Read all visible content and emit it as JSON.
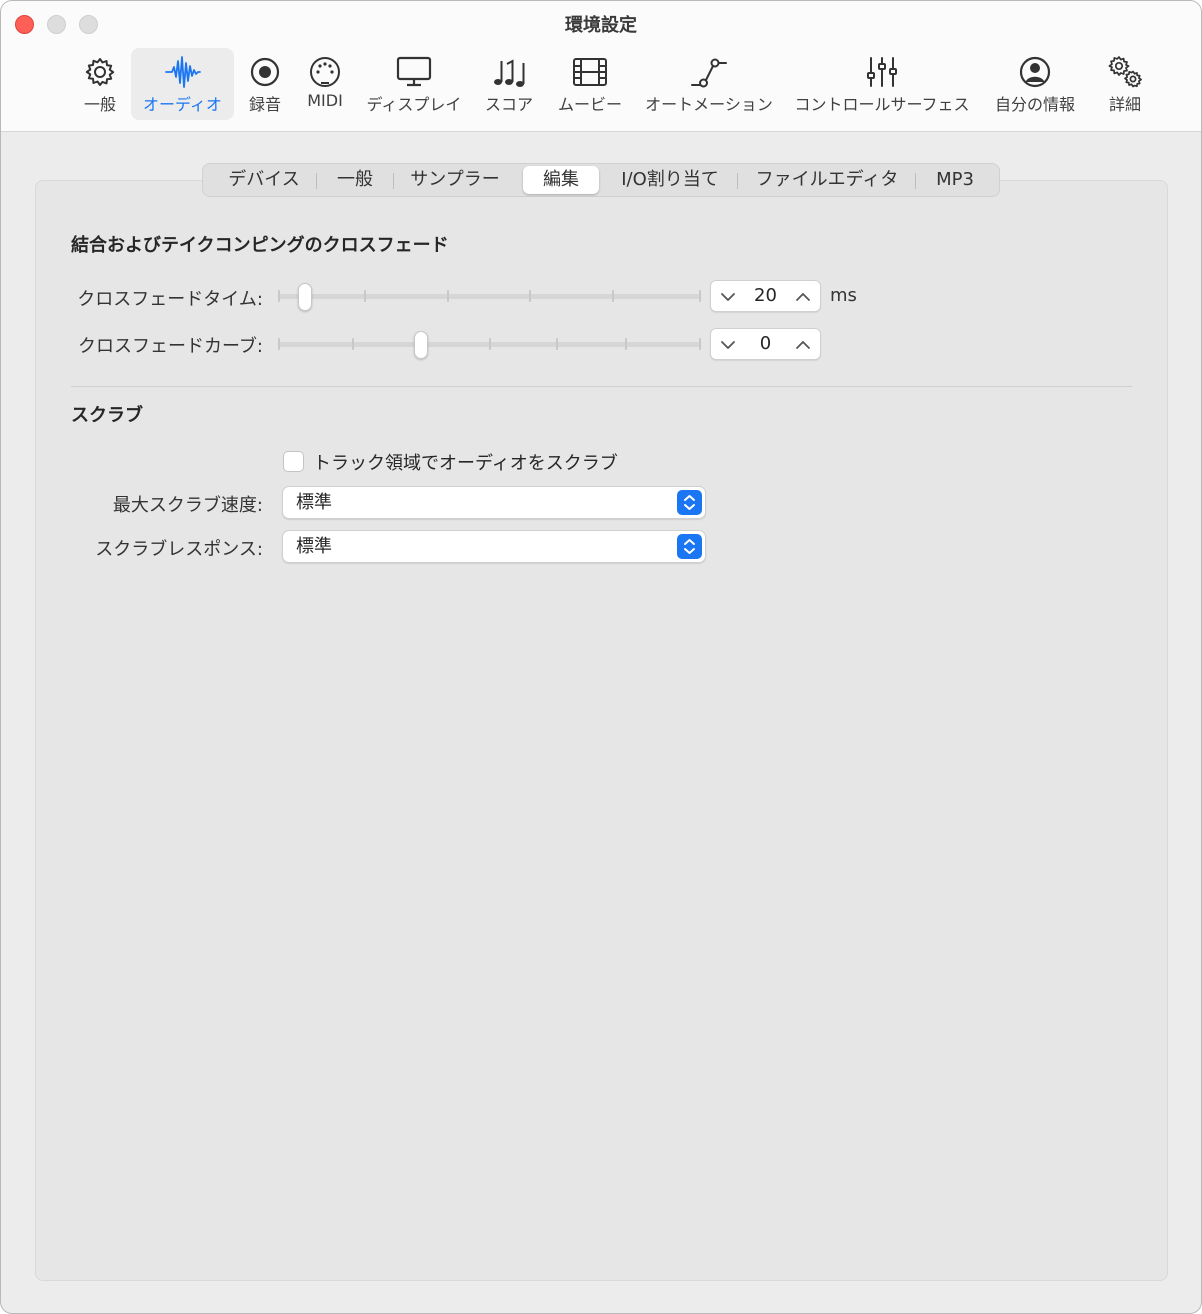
{
  "window": {
    "title": "環境設定"
  },
  "toolbar": {
    "items": [
      {
        "label": "一般",
        "icon": "gear-icon"
      },
      {
        "label": "オーディオ",
        "icon": "waveform-icon"
      },
      {
        "label": "録音",
        "icon": "record-icon"
      },
      {
        "label": "MIDI",
        "icon": "midi-connector-icon"
      },
      {
        "label": "ディスプレイ",
        "icon": "monitor-icon"
      },
      {
        "label": "スコア",
        "icon": "music-notes-icon"
      },
      {
        "label": "ムービー",
        "icon": "film-icon"
      },
      {
        "label": "オートメーション",
        "icon": "automation-icon"
      },
      {
        "label": "コントロールサーフェス",
        "icon": "faders-icon"
      },
      {
        "label": "自分の情報",
        "icon": "person-icon"
      },
      {
        "label": "詳細",
        "icon": "gears-icon"
      }
    ],
    "active_index": 1
  },
  "tabs": {
    "items": [
      "デバイス",
      "一般",
      "サンプラー",
      "編集",
      "I/O割り当て",
      "ファイルエディタ",
      "MP3"
    ],
    "active_index": 3
  },
  "crossfade": {
    "title": "結合およびテイクコンピングのクロスフェード",
    "time": {
      "label": "クロスフェードタイム:",
      "value": "20",
      "unit": "ms",
      "slider_fraction": 0.05
    },
    "curve": {
      "label": "クロスフェードカーブ:",
      "value": "0",
      "slider_fraction": 0.333
    }
  },
  "scrub": {
    "title": "スクラブ",
    "checkbox": {
      "label": "トラック領域でオーディオをスクラブ",
      "checked": false
    },
    "max_speed": {
      "label": "最大スクラブ速度:",
      "value": "標準"
    },
    "response": {
      "label": "スクラブレスポンス:",
      "value": "標準"
    }
  },
  "colors": {
    "accent": "#1a76f2",
    "close": "#fe5f57"
  }
}
